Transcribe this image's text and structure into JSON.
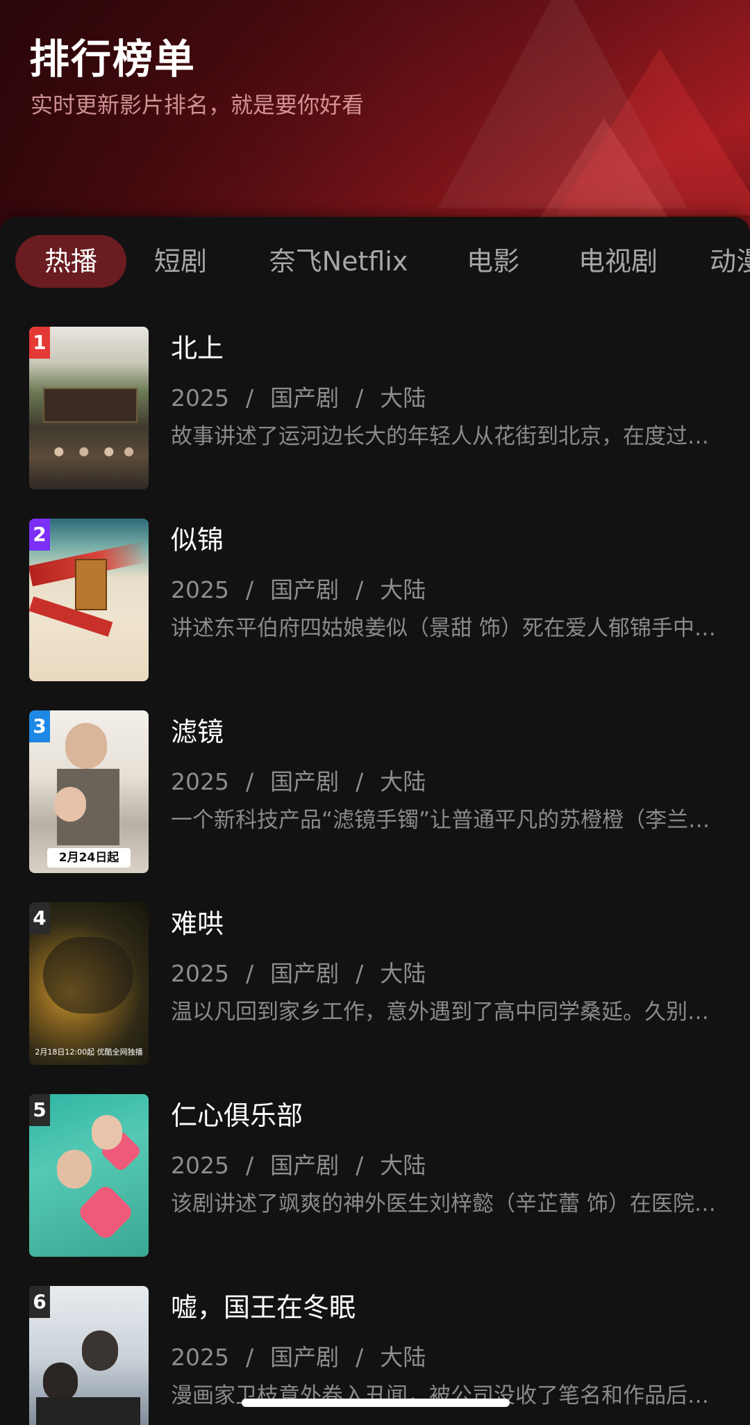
{
  "header": {
    "title": "排行榜单",
    "subtitle": "实时更新影片排名，就是要你好看"
  },
  "tabs": [
    {
      "label": "热播",
      "active": true
    },
    {
      "label": "短剧",
      "active": false
    },
    {
      "label": "奈飞Netflix",
      "active": false
    },
    {
      "label": "电影",
      "active": false
    },
    {
      "label": "电视剧",
      "active": false
    },
    {
      "label": "动漫",
      "active": false
    }
  ],
  "items": [
    {
      "rank": "1",
      "name": "北上",
      "year": "2025",
      "genre": "国产剧",
      "region": "大陆",
      "separator": "/",
      "desc": "故事讲述了运河边长大的年轻人从花街到北京，在度过人生的风雨之后又回到家乡的故事",
      "rank_color": "#e53935"
    },
    {
      "rank": "2",
      "name": "似锦",
      "year": "2025",
      "genre": "国产剧",
      "region": "大陆",
      "separator": "/",
      "desc": "讲述东平伯府四姑娘姜似（景甜 饰）死在爱人郁锦手中后重生的故事",
      "rank_color": "#7b2ff7"
    },
    {
      "rank": "3",
      "name": "滤镜",
      "year": "2025",
      "genre": "国产剧",
      "region": "大陆",
      "separator": "/",
      "desc": "一个新科技产品“滤镜手镯”让普通平凡的苏橙橙（李兰迪 饰）成为网红",
      "rank_color": "#1e88e5",
      "poster_text": "2月24日起"
    },
    {
      "rank": "4",
      "name": "难哄",
      "year": "2025",
      "genre": "国产剧",
      "region": "大陆",
      "separator": "/",
      "desc": "温以凡回到家乡工作，意外遇到了高中同学桑延。久别重逢后两人的故事",
      "rank_color": "#2a2a2a",
      "poster_text": "2月18日12:00起 优酷全网独播"
    },
    {
      "rank": "5",
      "name": "仁心俱乐部",
      "year": "2025",
      "genre": "国产剧",
      "region": "大陆",
      "separator": "/",
      "desc": "该剧讲述了飒爽的神外医生刘梓懿（辛芷蕾 饰）在医院里的故事",
      "rank_color": "#2a2a2a"
    },
    {
      "rank": "6",
      "name": "嘘，国王在冬眠",
      "year": "2025",
      "genre": "国产剧",
      "region": "大陆",
      "separator": "/",
      "desc": "漫画家卫枝意外卷入丑闻，被公司没收了笔名和作品后的故事",
      "rank_color": "#2a2a2a"
    }
  ]
}
